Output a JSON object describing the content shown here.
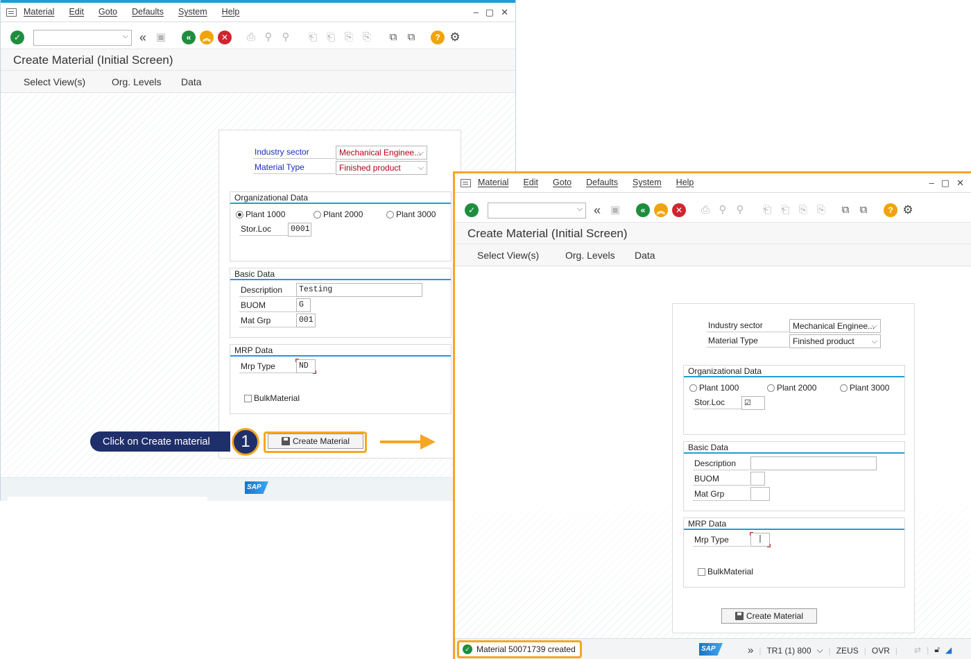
{
  "menu": [
    "Material",
    "Edit",
    "Goto",
    "Defaults",
    "System",
    "Help"
  ],
  "window_controls": {
    "minimize": "–",
    "maximize": "▢",
    "close": "✕"
  },
  "title": "Create Material (Initial Screen)",
  "app_toolbar": [
    "Select View(s)",
    "Org. Levels",
    "Data"
  ],
  "command_field": {
    "value": ""
  },
  "form": {
    "industry_sector_label": "Industry sector",
    "material_type_label": "Material Type",
    "org_data_title": "Organizational Data",
    "plants": [
      "Plant 1000",
      "Plant 2000",
      "Plant 3000"
    ],
    "stor_loc_label": "Stor.Loc",
    "basic_data_title": "Basic Data",
    "description_label": "Description",
    "buom_label": "BUOM",
    "mat_grp_label": "Mat Grp",
    "mrp_data_title": "MRP Data",
    "mrp_type_label": "Mrp Type",
    "bulk_label": "BulkMaterial",
    "create_button": "Create Material"
  },
  "screen1": {
    "industry_sector": "Mechanical Enginee...",
    "material_type": "Finished product",
    "selected_plant": 0,
    "stor_loc": "0001",
    "description": "Testing",
    "buom": "G",
    "mat_grp": "001",
    "mrp_type": "ND"
  },
  "screen2": {
    "industry_sector": "Mechanical Enginee...",
    "material_type": "Finished product",
    "stor_loc_check": "☑",
    "description": "",
    "buom": "",
    "mat_grp": "",
    "mrp_type": "|"
  },
  "callout": {
    "text": "Click on Create material",
    "step": "1"
  },
  "sap_logo": "SAP",
  "status": {
    "message": "Material 50071739 created",
    "system": "TR1 (1) 800",
    "server": "ZEUS",
    "mode": "OVR"
  },
  "colors": {
    "accent": "#1a9fd9",
    "highlight": "#f5a623",
    "callout": "#1f2f6b",
    "required": "#b3001b",
    "label_blue": "#1a2dbd"
  }
}
